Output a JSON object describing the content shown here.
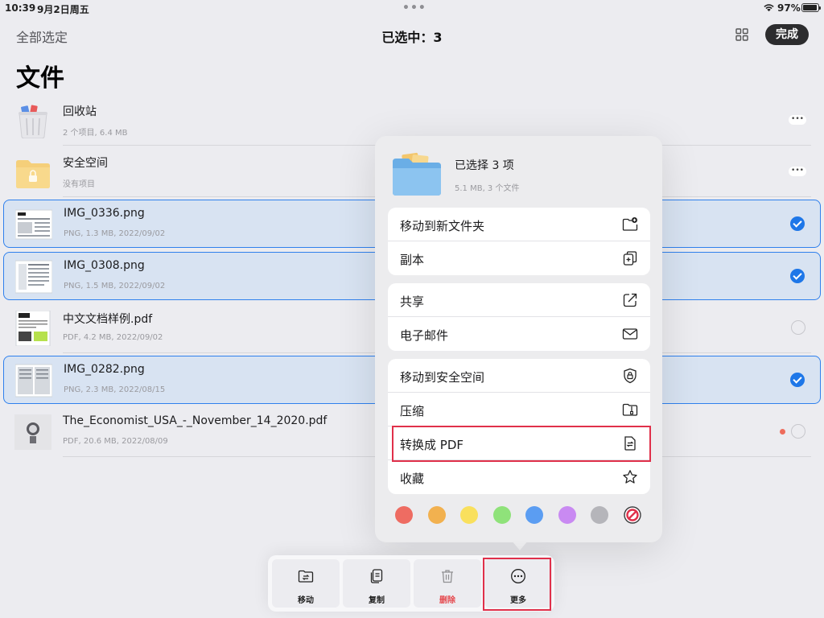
{
  "status_bar": {
    "time": "10:39",
    "date": "9月2日周五",
    "multitask_dots": "•••",
    "battery_percent": "97%"
  },
  "nav": {
    "select_all": "全部选定",
    "title": "已选中：3",
    "done": "完成"
  },
  "page_title": "文件",
  "files": [
    {
      "name": "回收站",
      "meta": "2 个项目, 6.4 MB",
      "state": "more"
    },
    {
      "name": "安全空间",
      "meta": "没有项目",
      "state": "more"
    },
    {
      "name": "IMG_0336.png",
      "meta": "PNG, 1.3 MB, 2022/09/02",
      "state": "checked"
    },
    {
      "name": "IMG_0308.png",
      "meta": "PNG, 1.5 MB, 2022/09/02",
      "state": "checked"
    },
    {
      "name": "中文文档样例.pdf",
      "meta": "PDF, 4.2 MB, 2022/09/02",
      "state": "unchecked"
    },
    {
      "name": "IMG_0282.png",
      "meta": "PNG, 2.3 MB, 2022/08/15",
      "state": "checked"
    },
    {
      "name": "The_Economist_USA_-_November_14_2020.pdf",
      "meta": "PDF, 20.6 MB, 2022/08/09",
      "state": "unchecked",
      "tag_color": "#ee6c5c"
    }
  ],
  "more_dots_glyph": "•••",
  "popup": {
    "title": "已选择 3 项",
    "subtitle": "5.1 MB, 3 个文件",
    "groups": [
      [
        {
          "label": "移动到新文件夹",
          "icon": "new-folder-icon"
        },
        {
          "label": "副本",
          "icon": "duplicate-icon"
        }
      ],
      [
        {
          "label": "共享",
          "icon": "share-icon"
        },
        {
          "label": "电子邮件",
          "icon": "mail-icon"
        }
      ],
      [
        {
          "label": "移动到安全空间",
          "icon": "lock-shield-icon"
        },
        {
          "label": "压缩",
          "icon": "zip-icon"
        },
        {
          "label": "转换成 PDF",
          "icon": "convert-pdf-icon"
        },
        {
          "label": "收藏",
          "icon": "star-icon"
        }
      ]
    ],
    "tag_colors": [
      "#ee6c62",
      "#f2b14f",
      "#f9e05d",
      "#8fe27a",
      "#5b9df2",
      "#c98af2",
      "#b5b5ba"
    ]
  },
  "toolbar": {
    "move": "移动",
    "copy": "复制",
    "delete": "删除",
    "more": "更多"
  }
}
